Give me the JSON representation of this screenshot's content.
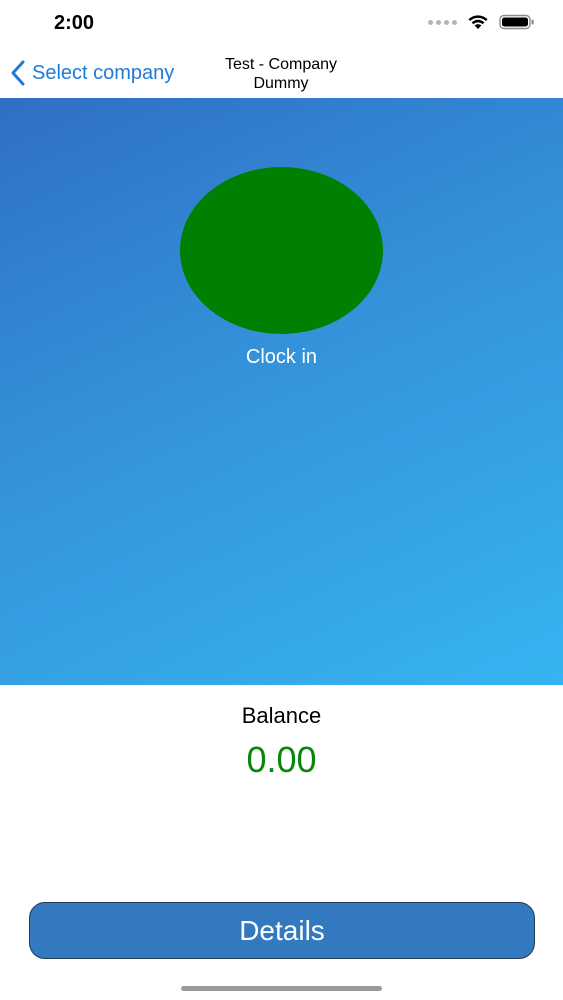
{
  "status_bar": {
    "time": "2:00",
    "icons": [
      "signal-icon",
      "wifi-icon",
      "battery-icon"
    ]
  },
  "nav": {
    "back_label": "Select company",
    "title": "Test - Company Dummy",
    "back_icon": "chevron-left-icon"
  },
  "clock": {
    "label": "Clock in",
    "color": "#008000"
  },
  "balance": {
    "label": "Balance",
    "value": "0.00",
    "value_color": "#0a870a"
  },
  "details": {
    "label": "Details"
  },
  "colors": {
    "accent": "#1e7ad9",
    "hero_start": "#2f6fc4",
    "hero_end": "#36b4f2",
    "button": "#3279c0"
  }
}
